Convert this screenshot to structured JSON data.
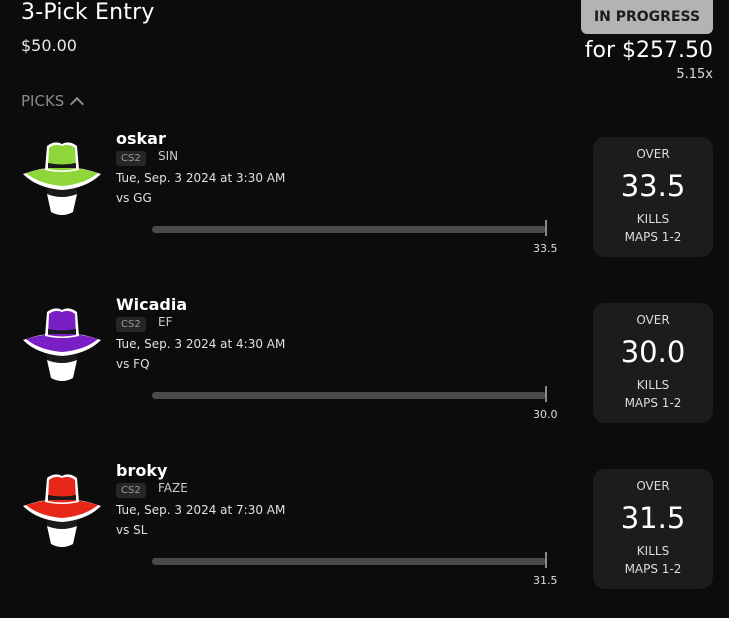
{
  "entry": {
    "title": "3-Pick Entry",
    "stake": "$50.00",
    "status": "IN PROGRESS",
    "payout": "for $257.50",
    "multiplier": "5.15x",
    "picks_header": "PICKS"
  },
  "picks": [
    {
      "player": "oskar",
      "game": "CS2",
      "team": "SIN",
      "time": "Tue, Sep. 3 2024 at 3:30 AM",
      "opponent": "vs GG",
      "bar_label": "33.5",
      "direction": "OVER",
      "line": "33.5",
      "stat": "KILLS",
      "maps": "MAPS 1-2",
      "hat_color": "#8fd63a"
    },
    {
      "player": "Wicadia",
      "game": "CS2",
      "team": "EF",
      "time": "Tue, Sep. 3 2024 at 4:30 AM",
      "opponent": "vs FQ",
      "bar_label": "30.0",
      "direction": "OVER",
      "line": "30.0",
      "stat": "KILLS",
      "maps": "MAPS 1-2",
      "hat_color": "#7a1fc4"
    },
    {
      "player": "broky",
      "game": "CS2",
      "team": "FAZE",
      "time": "Tue, Sep. 3 2024 at 7:30 AM",
      "opponent": "vs SL",
      "bar_label": "31.5",
      "direction": "OVER",
      "line": "31.5",
      "stat": "KILLS",
      "maps": "MAPS 1-2",
      "hat_color": "#e8261a"
    }
  ]
}
